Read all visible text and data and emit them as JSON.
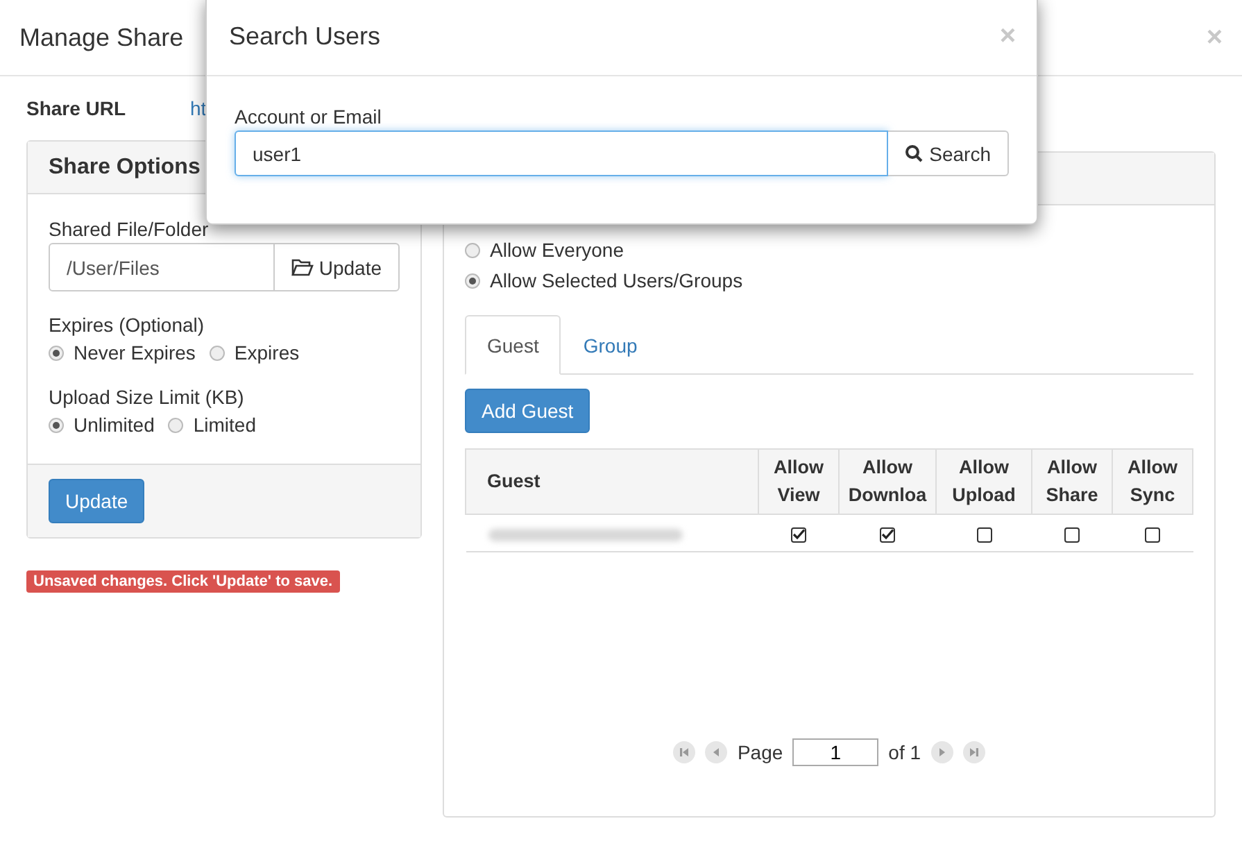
{
  "dialog": {
    "title": "Manage Share",
    "close": "×"
  },
  "share_url": {
    "label": "Share URL",
    "value": "ht"
  },
  "share_options": {
    "title": "Share Options",
    "file_label": "Shared File/Folder",
    "file_value": "/User/Files",
    "file_button": "Update",
    "expires": {
      "label": "Expires (Optional)",
      "options": [
        {
          "label": "Never Expires",
          "selected": true
        },
        {
          "label": "Expires",
          "selected": false
        }
      ]
    },
    "upload_limit": {
      "label": "Upload Size Limit (KB)",
      "options": [
        {
          "label": "Unlimited",
          "selected": true
        },
        {
          "label": "Limited",
          "selected": false
        }
      ]
    },
    "update_button": "Update"
  },
  "alert": "Unsaved changes. Click 'Update' to save.",
  "access": {
    "options": [
      {
        "label": "Allow Everyone",
        "selected": false
      },
      {
        "label": "Allow Selected Users/Groups",
        "selected": true
      }
    ],
    "tabs": [
      {
        "label": "Guest",
        "selected": true
      },
      {
        "label": "Group",
        "selected": false
      }
    ],
    "add_button": "Add Guest",
    "table": {
      "columns": [
        "Guest",
        "Allow View",
        "Allow Downloa",
        "Allow Upload",
        "Allow Share",
        "Allow Sync"
      ],
      "rows": [
        {
          "permissions": [
            {
              "checked": true
            },
            {
              "checked": true
            },
            {
              "checked": false
            },
            {
              "checked": false
            },
            {
              "checked": false
            }
          ]
        }
      ]
    },
    "pagination": {
      "page_label": "Page",
      "page": "1",
      "of": "of 1"
    }
  },
  "search_modal": {
    "title": "Search Users",
    "close": "×",
    "label": "Account or Email",
    "value": "user1",
    "button": "Search"
  }
}
